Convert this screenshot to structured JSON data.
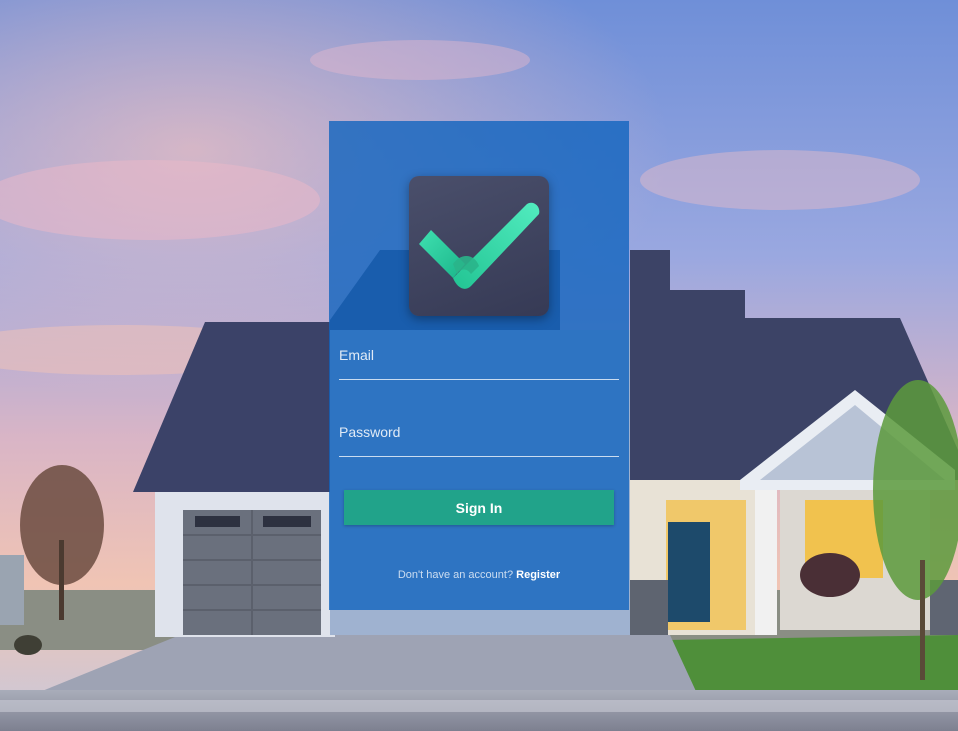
{
  "login": {
    "logo_icon": "checkmark-icon",
    "email_label": "Email",
    "email_value": "",
    "password_label": "Password",
    "password_value": "",
    "signin_label": "Sign In",
    "register_prompt": "Don't have an account?",
    "register_label": "Register"
  },
  "colors": {
    "panel": "#1264be",
    "button": "#21a38a",
    "logo_bg": "#3e425e",
    "check": "#35d6a4"
  }
}
